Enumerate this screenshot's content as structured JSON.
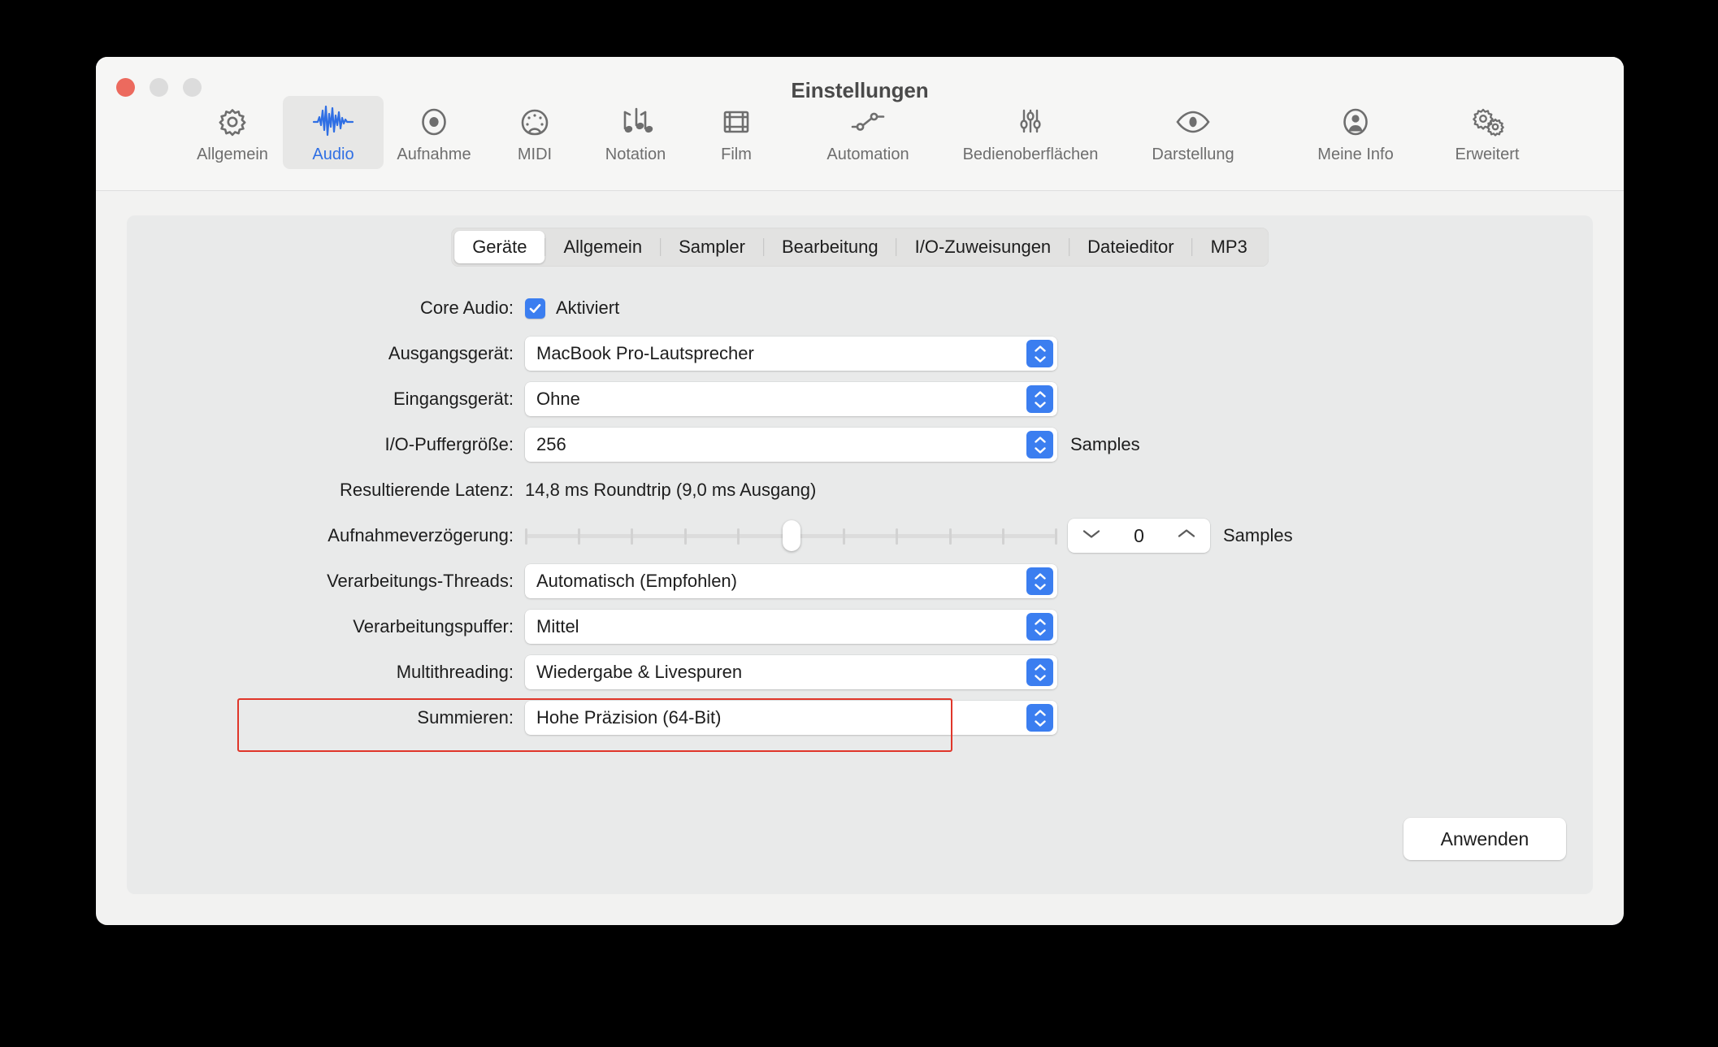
{
  "window": {
    "title": "Einstellungen",
    "traffic_lights": [
      "close",
      "minimize",
      "maximize"
    ]
  },
  "toolbar": {
    "items": [
      {
        "label": "Allgemein",
        "icon": "gear-icon",
        "selected": false
      },
      {
        "label": "Audio",
        "icon": "waveform-icon",
        "selected": true
      },
      {
        "label": "Aufnahme",
        "icon": "record-circle-icon",
        "selected": false
      },
      {
        "label": "MIDI",
        "icon": "midi-port-icon",
        "selected": false
      },
      {
        "label": "Notation",
        "icon": "music-notes-icon",
        "selected": false
      },
      {
        "label": "Film",
        "icon": "film-strip-icon",
        "selected": false
      },
      {
        "label": "Automation",
        "icon": "automation-node-icon",
        "selected": false
      },
      {
        "label": "Bedienoberflächen",
        "icon": "sliders-icon",
        "selected": false
      },
      {
        "label": "Darstellung",
        "icon": "eye-icon",
        "selected": false
      },
      {
        "label": "Meine Info",
        "icon": "person-circle-icon",
        "selected": false
      },
      {
        "label": "Erweitert",
        "icon": "double-gear-icon",
        "selected": false
      }
    ]
  },
  "tabs": [
    {
      "label": "Geräte",
      "active": true
    },
    {
      "label": "Allgemein",
      "active": false
    },
    {
      "label": "Sampler",
      "active": false
    },
    {
      "label": "Bearbeitung",
      "active": false
    },
    {
      "label": "I/O-Zuweisungen",
      "active": false
    },
    {
      "label": "Dateieditor",
      "active": false
    },
    {
      "label": "MP3",
      "active": false
    }
  ],
  "form": {
    "core_audio": {
      "label": "Core Audio:",
      "checkbox_label": "Aktiviert",
      "checked": true
    },
    "output_device": {
      "label": "Ausgangsgerät:",
      "value": "MacBook Pro-Lautsprecher"
    },
    "input_device": {
      "label": "Eingangsgerät:",
      "value": "Ohne"
    },
    "io_buffer": {
      "label": "I/O-Puffergröße:",
      "value": "256",
      "unit": "Samples"
    },
    "latency": {
      "label": "Resultierende Latenz:",
      "value": "14,8 ms Roundtrip (9,0 ms Ausgang)"
    },
    "recording_delay": {
      "label": "Aufnahmeverzögerung:",
      "slider_ticks": 11,
      "slider_position_index": 5,
      "stepper_value": "0",
      "unit": "Samples"
    },
    "processing_threads": {
      "label": "Verarbeitungs-Threads:",
      "value": "Automatisch (Empfohlen)"
    },
    "processing_buffer": {
      "label": "Verarbeitungspuffer:",
      "value": "Mittel"
    },
    "multithreading": {
      "label": "Multithreading:",
      "value": "Wiedergabe & Livespuren"
    },
    "summing": {
      "label": "Summieren:",
      "value": "Hohe Präzision (64-Bit)",
      "highlighted": true
    }
  },
  "apply_button": {
    "label": "Anwenden"
  },
  "colors": {
    "accent": "#3b7ef0",
    "selected_tab_text": "#2f6fe4",
    "highlight_border": "#e0362a",
    "close_button": "#ec6a5e",
    "window_bg": "#f2f2f1",
    "panel_bg": "#e9eaea"
  }
}
